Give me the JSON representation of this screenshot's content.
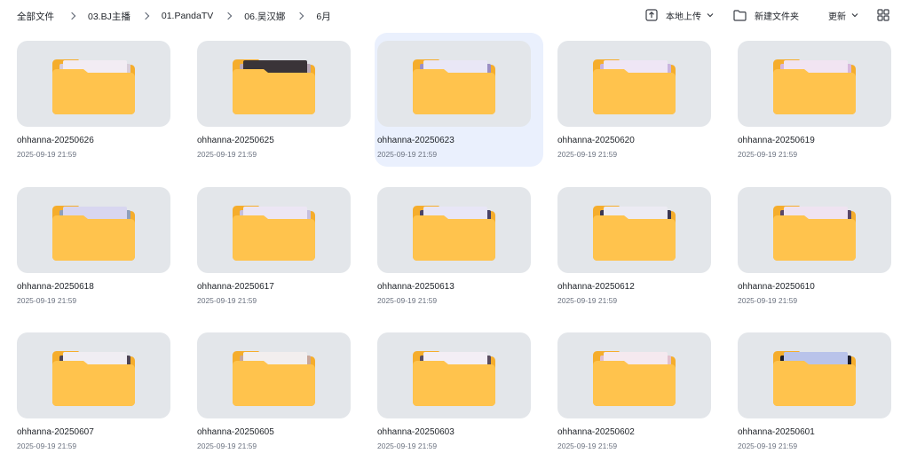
{
  "breadcrumb": [
    "全部文件",
    "03.BJ主播",
    "01.PandaTV",
    "06.吴汉娜",
    "6月"
  ],
  "toolbar": {
    "upload_label": "本地上传",
    "new_folder_label": "新建文件夹",
    "sort_label": "更新"
  },
  "icons": {
    "upload": "upload-icon",
    "new_folder": "folder-outline-icon",
    "chevron": "chevron-down-icon",
    "view_toggle": "grid-view-icon",
    "folder": "folder-icon"
  },
  "colors": {
    "folder": "#ffc34d",
    "folder_back": "#f5ad2c",
    "thumb_bg": "#e3e6ea",
    "selected_bg": "#eaf0fd"
  },
  "selected_index": 2,
  "folders": [
    {
      "name": "ohhanna-20250626",
      "date": "2025-09-19 21:59",
      "preview": [
        "#f2ecf3",
        "#d8cdd9"
      ]
    },
    {
      "name": "ohhanna-20250625",
      "date": "2025-09-19 21:59",
      "preview": [
        "#3a3438",
        "#b9a8b7"
      ]
    },
    {
      "name": "ohhanna-20250623",
      "date": "2025-09-19 21:59",
      "preview": [
        "#e9e7f6",
        "#9b8fc4"
      ]
    },
    {
      "name": "ohhanna-20250620",
      "date": "2025-09-19 21:59",
      "preview": [
        "#efe6f5",
        "#c9b4df"
      ]
    },
    {
      "name": "ohhanna-20250619",
      "date": "2025-09-19 21:59",
      "preview": [
        "#f1e4f2",
        "#d7b7dd"
      ]
    },
    {
      "name": "ohhanna-20250618",
      "date": "2025-09-19 21:59",
      "preview": [
        "#d8d6f0",
        "#8f9fba"
      ]
    },
    {
      "name": "ohhanna-20250617",
      "date": "2025-09-19 21:59",
      "preview": [
        "#ece6f4",
        "#c7c0de"
      ]
    },
    {
      "name": "ohhanna-20250613",
      "date": "2025-09-19 21:59",
      "preview": [
        "#e8e6f6",
        "#4a4366"
      ]
    },
    {
      "name": "ohhanna-20250612",
      "date": "2025-09-19 21:59",
      "preview": [
        "#ecebf3",
        "#3b3752"
      ]
    },
    {
      "name": "ohhanna-20250610",
      "date": "2025-09-19 21:59",
      "preview": [
        "#efe3f1",
        "#5a4767"
      ]
    },
    {
      "name": "ohhanna-20250607",
      "date": "2025-09-19 21:59",
      "preview": [
        "#f0edf3",
        "#4e4454"
      ]
    },
    {
      "name": "ohhanna-20250605",
      "date": "2025-09-19 21:59",
      "preview": [
        "#f2eeee",
        "#c9a79a"
      ]
    },
    {
      "name": "ohhanna-20250603",
      "date": "2025-09-19 21:59",
      "preview": [
        "#f3eef5",
        "#5a4d5f"
      ]
    },
    {
      "name": "ohhanna-20250602",
      "date": "2025-09-19 21:59",
      "preview": [
        "#f5e9ef",
        "#e2c0cd"
      ]
    },
    {
      "name": "ohhanna-20250601",
      "date": "2025-09-19 21:59",
      "preview": [
        "#b9c3ea",
        "#1c1c2a"
      ]
    }
  ]
}
